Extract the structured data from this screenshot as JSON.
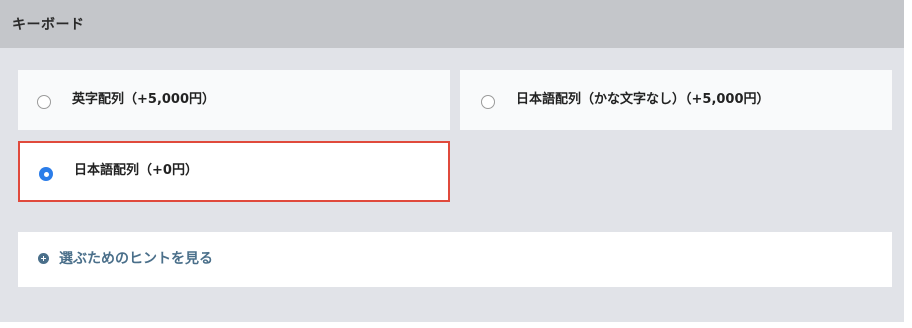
{
  "section": {
    "title": "キーボード"
  },
  "options": [
    {
      "label": "英字配列（+5,000円）",
      "selected": false
    },
    {
      "label": "日本語配列（かな文字なし）（+5,000円）",
      "selected": false
    },
    {
      "label": "日本語配列（+0円）",
      "selected": true
    }
  ],
  "hint": {
    "label": "選ぶためのヒントを見る",
    "icon": "plus-circle-icon"
  },
  "colors": {
    "header_bg": "#c4c6ca",
    "panel_bg": "#e1e3e8",
    "selected_border": "#e04a3c",
    "radio_selected": "#2b7de9",
    "hint_text": "#4a6f8a"
  }
}
